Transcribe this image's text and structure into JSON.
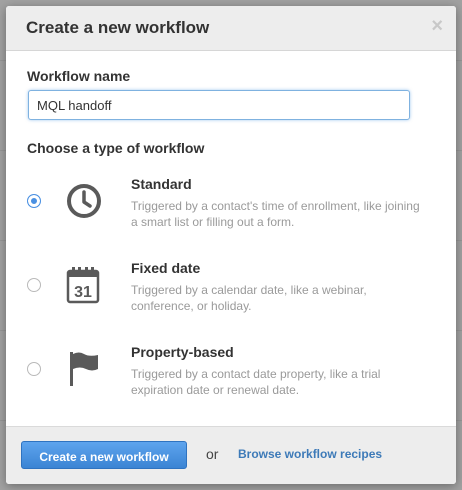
{
  "modal": {
    "title": "Create a new workflow",
    "close_glyph": "×"
  },
  "workflow_name": {
    "label": "Workflow name",
    "value": "MQL handoff"
  },
  "workflow_type": {
    "label": "Choose a type of workflow",
    "options": [
      {
        "title": "Standard",
        "description": "Triggered by a contact's time of enrollment, like joining a smart list or filling out a form.",
        "icon": "clock-icon",
        "selected": true
      },
      {
        "title": "Fixed date",
        "description": "Triggered by a calendar date, like a webinar, conference, or holiday.",
        "icon": "calendar-icon",
        "calendar_day": "31",
        "selected": false
      },
      {
        "title": "Property-based",
        "description": "Triggered by a contact date property, like a trial expiration date or renewal date.",
        "icon": "flag-icon",
        "selected": false
      }
    ]
  },
  "footer": {
    "primary_label": "Create a new workflow",
    "or_text": "or",
    "link_label": "Browse workflow recipes"
  },
  "colors": {
    "accent": "#4a90e2",
    "link": "#3d7ab8",
    "icon": "#5a5a5a"
  }
}
